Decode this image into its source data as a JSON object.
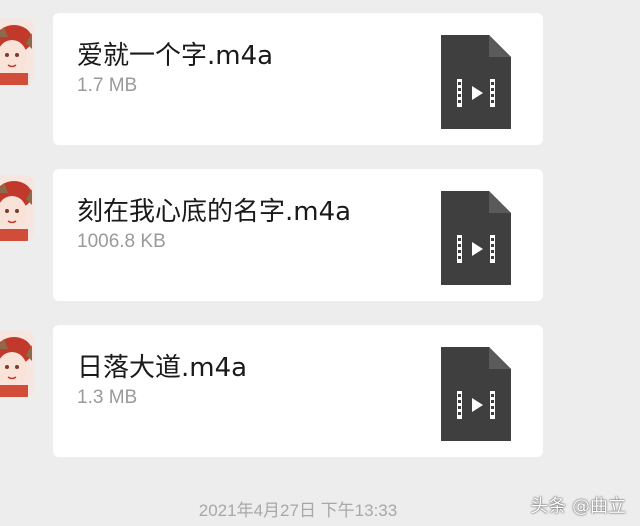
{
  "messages": [
    {
      "file_name": "爱就一个字.m4a",
      "file_size": "1.7 MB",
      "icon": "video-file-icon"
    },
    {
      "file_name": "刻在我心底的名字.m4a",
      "file_size": "1006.8 KB",
      "icon": "video-file-icon"
    },
    {
      "file_name": "日落大道.m4a",
      "file_size": "1.3 MB",
      "icon": "video-file-icon"
    }
  ],
  "timestamp": "2021年4月27日 下午13:33",
  "watermark": "头条 @曲立",
  "colors": {
    "background": "#ededed",
    "bubble": "#ffffff",
    "file_icon": "#3f3f3f",
    "size_text": "#9a9a9a",
    "timestamp_text": "#a8a8a8"
  }
}
